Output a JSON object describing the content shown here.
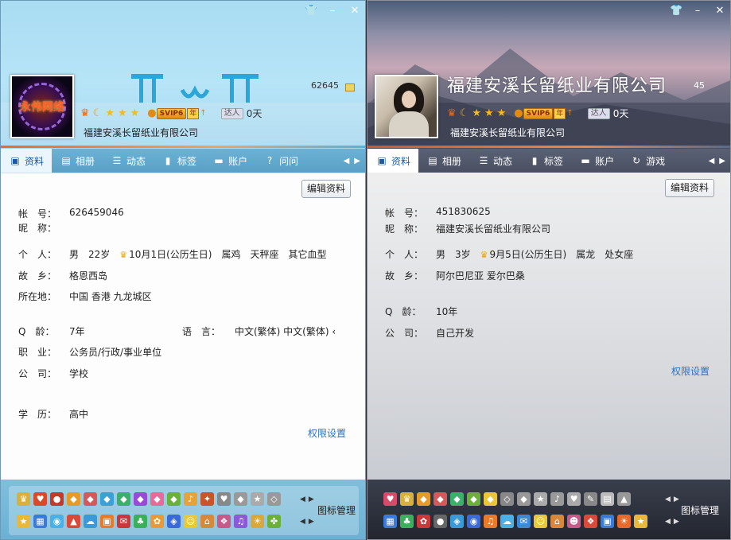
{
  "left": {
    "qq_number": "62645",
    "signature": "福建安溪长留纸业有限公司",
    "daren_label": "达人",
    "daren_days": "0天",
    "svip": "SVIP6",
    "svip_year": "年",
    "tabs": [
      {
        "label": "资料",
        "icon": "profile-card-icon"
      },
      {
        "label": "相册",
        "icon": "photo-album-icon"
      },
      {
        "label": "动态",
        "icon": "feed-list-icon"
      },
      {
        "label": "标签",
        "icon": "bookmark-tag-icon"
      },
      {
        "label": "账户",
        "icon": "wallet-icon"
      },
      {
        "label": "问问",
        "icon": "question-icon"
      }
    ],
    "edit_button": "编辑资料",
    "fields": {
      "account_label": "帐　号：",
      "account": "626459046",
      "nick_label": "昵　称：",
      "nick": "",
      "personal_label": "个　人：",
      "gender": "男",
      "age": "22岁",
      "birthday": "10月1日(公历生日)",
      "zodiac": "属鸡",
      "constellation": "天秤座",
      "blood": "其它血型",
      "hometown_label": "故　乡：",
      "hometown": "格恩西岛",
      "location_label": "所在地：",
      "location": "中国 香港 九龙城区",
      "qage_label": "Q　龄：",
      "qage": "7年",
      "lang_label": "语　言：",
      "lang": "中文(繁体) 中文(繁体) ‹",
      "job_label": "职　业：",
      "job": "公务员/行政/事业单位",
      "company_label": "公　司：",
      "company": "学校",
      "edu_label": "学　历：",
      "edu": "高中"
    },
    "perm_link": "权限设置",
    "icon_manager": "图标管理"
  },
  "right": {
    "big_nick": "福建安溪长留纸业有限公司",
    "qq_number": "45",
    "signature": "福建安溪长留纸业有限公司",
    "daren_label": "达人",
    "daren_days": "0天",
    "svip": "SVIP6",
    "svip_year": "年",
    "tabs": [
      {
        "label": "资料",
        "icon": "profile-card-icon"
      },
      {
        "label": "相册",
        "icon": "photo-album-icon"
      },
      {
        "label": "动态",
        "icon": "feed-list-icon"
      },
      {
        "label": "标签",
        "icon": "bookmark-tag-icon"
      },
      {
        "label": "账户",
        "icon": "wallet-icon"
      },
      {
        "label": "游戏",
        "icon": "game-icon"
      }
    ],
    "edit_button": "编辑资料",
    "fields": {
      "account_label": "帐　号：",
      "account": "451830625",
      "nick_label": "昵　称：",
      "nick": "福建安溪长留纸业有限公司",
      "personal_label": "个　人：",
      "gender": "男",
      "age": "3岁",
      "birthday": "9月5日(公历生日)",
      "zodiac": "属龙",
      "constellation": "处女座",
      "hometown_label": "故　乡：",
      "hometown": "阿尔巴尼亚 爱尔巴桑",
      "qage_label": "Q　龄：",
      "qage": "10年",
      "company_label": "公　司：",
      "company": "自己开发"
    },
    "perm_link": "权限设置",
    "icon_manager": "图标管理"
  },
  "colors": {
    "link": "#2a72c0",
    "tab_active_text": "#1a5aa0",
    "left_header": "#a9dcf2",
    "right_header": "#6c6f82"
  }
}
